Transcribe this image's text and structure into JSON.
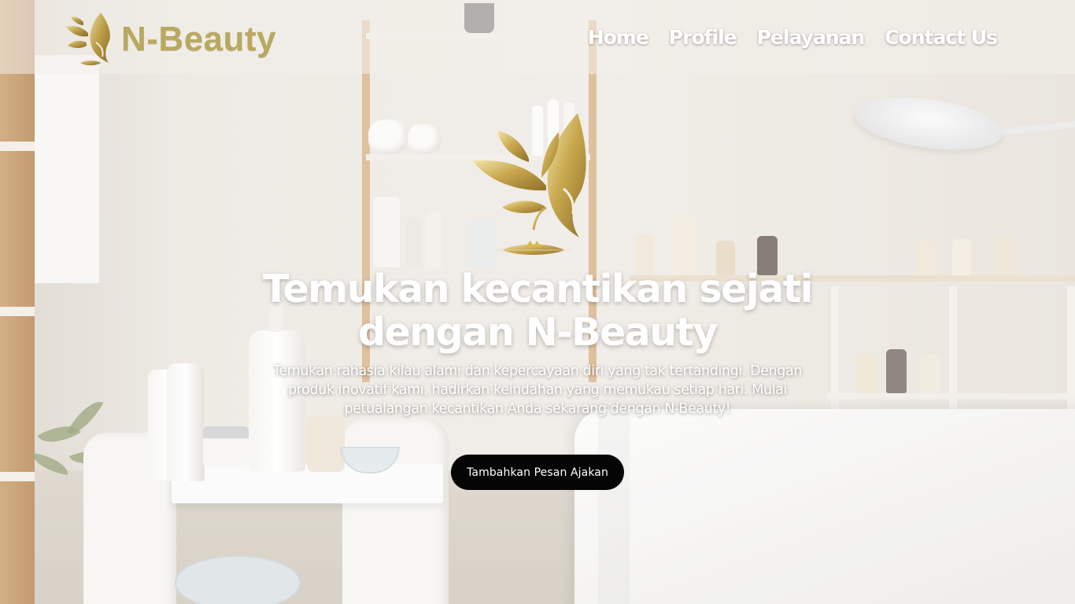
{
  "brand": {
    "name": "N-Beauty",
    "logo_icon": "lotus-face-icon",
    "gold": "#c2ad5a"
  },
  "nav": {
    "items": [
      {
        "label": "Home"
      },
      {
        "label": "Profile"
      },
      {
        "label": "Pelayanan"
      },
      {
        "label": "Contact Us"
      }
    ]
  },
  "hero": {
    "logo_icon": "lotus-face-icon",
    "title": "Temukan kecantikan sejati dengan N-Beauty",
    "subtitle": "Temukan rahasia kilau alami dan kepercayaan diri yang tak tertandingi. Dengan produk inovatif kami, hadirkan keindahan yang memukau setiap hari. Mulai petualangan kecantikan Anda sekarang dengan N-Beauty!",
    "cta_label": "Tambahkan Pesan Ajakan",
    "cta_color": "#050505"
  }
}
